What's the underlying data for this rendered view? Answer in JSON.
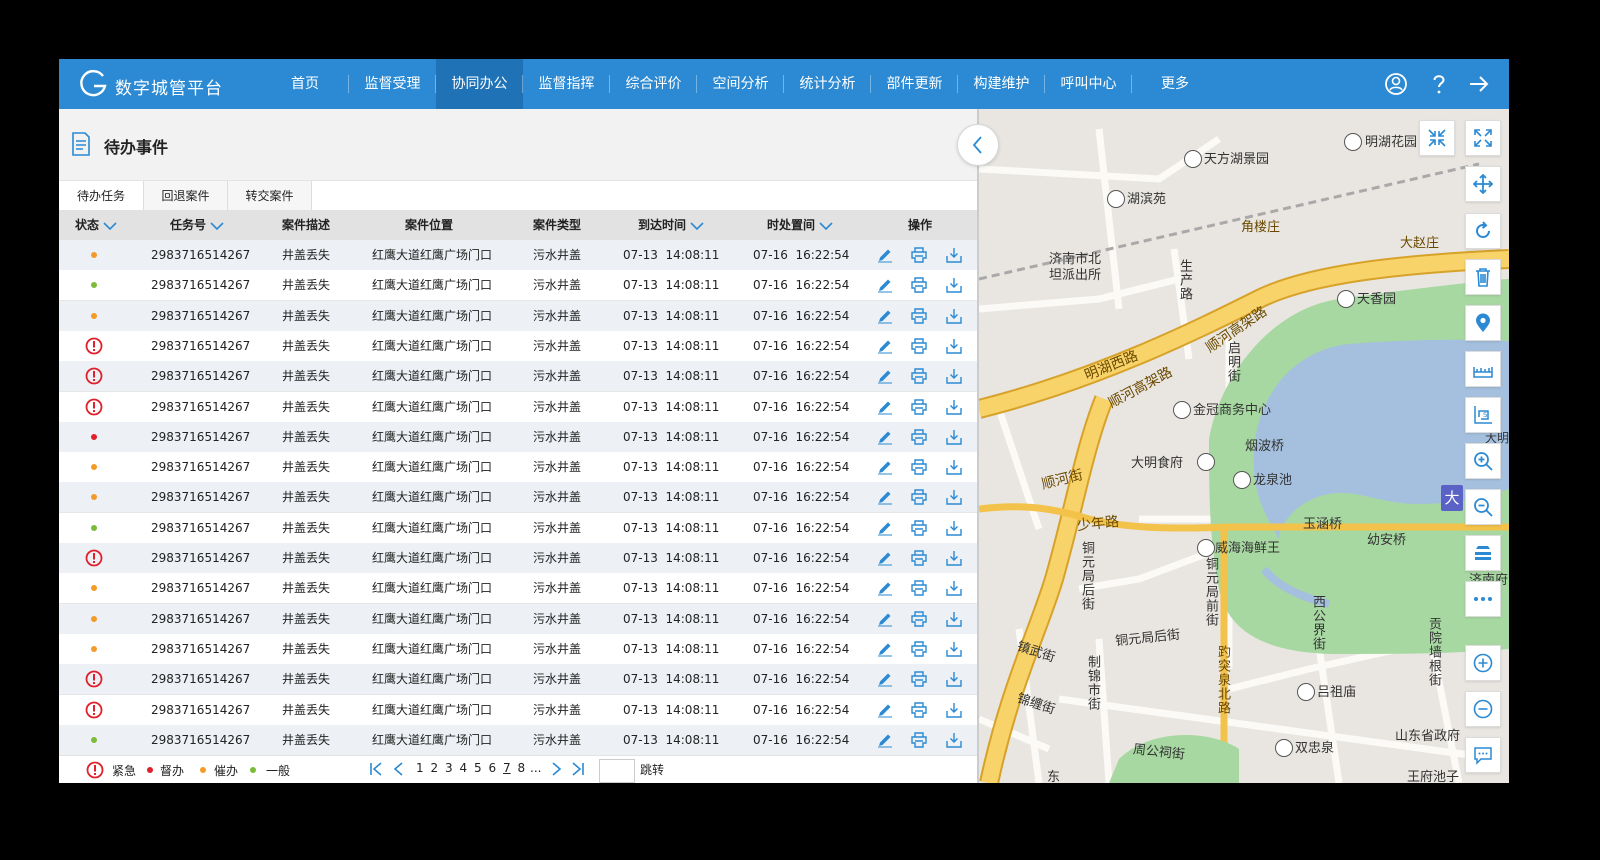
{
  "header": {
    "brand": "数字城管平台",
    "nav": [
      {
        "label": "首页"
      },
      {
        "label": "监督受理"
      },
      {
        "label": "协同办公"
      },
      {
        "label": "监督指挥"
      },
      {
        "label": "综合评价"
      },
      {
        "label": "空间分析"
      },
      {
        "label": "统计分析"
      },
      {
        "label": "部件更新"
      },
      {
        "label": "构建维护"
      },
      {
        "label": "呼叫中心"
      },
      {
        "label": "更多"
      }
    ],
    "active_nav": "协同办公",
    "icons": [
      "user-icon",
      "help-icon",
      "logout-icon"
    ],
    "color": "#2b8ad3"
  },
  "panel": {
    "title": "待办事件",
    "tabs": [
      "待办任务",
      "回退案件",
      "转交案件"
    ],
    "columns": {
      "status": "状态",
      "task_no": "任务号",
      "desc": "案件描述",
      "location": "案件位置",
      "type": "案件类型",
      "arrival": "到达时间",
      "deadline": "时处置间",
      "ops": "操作"
    },
    "rows": [
      {
        "status": "warn",
        "task_no": "2983716514267",
        "desc": "井盖丢失",
        "location": "红鹰大道红鹰广场门口",
        "type": "污水井盖",
        "arrival": "07-13  14:08:11",
        "deadline": "07-16  16:22:54"
      },
      {
        "status": "normal",
        "task_no": "2983716514267",
        "desc": "井盖丢失",
        "location": "红鹰大道红鹰广场门口",
        "type": "污水井盖",
        "arrival": "07-13  14:08:11",
        "deadline": "07-16  16:22:54"
      },
      {
        "status": "warn",
        "task_no": "2983716514267",
        "desc": "井盖丢失",
        "location": "红鹰大道红鹰广场门口",
        "type": "污水井盖",
        "arrival": "07-13  14:08:11",
        "deadline": "07-16  16:22:54"
      },
      {
        "status": "urgent",
        "task_no": "2983716514267",
        "desc": "井盖丢失",
        "location": "红鹰大道红鹰广场门口",
        "type": "污水井盖",
        "arrival": "07-13  14:08:11",
        "deadline": "07-16  16:22:54"
      },
      {
        "status": "urgent",
        "task_no": "2983716514267",
        "desc": "井盖丢失",
        "location": "红鹰大道红鹰广场门口",
        "type": "污水井盖",
        "arrival": "07-13  14:08:11",
        "deadline": "07-16  16:22:54"
      },
      {
        "status": "urgent",
        "task_no": "2983716514267",
        "desc": "井盖丢失",
        "location": "红鹰大道红鹰广场门口",
        "type": "污水井盖",
        "arrival": "07-13  14:08:11",
        "deadline": "07-16  16:22:54"
      },
      {
        "status": "supervise",
        "task_no": "2983716514267",
        "desc": "井盖丢失",
        "location": "红鹰大道红鹰广场门口",
        "type": "污水井盖",
        "arrival": "07-13  14:08:11",
        "deadline": "07-16  16:22:54"
      },
      {
        "status": "warn",
        "task_no": "2983716514267",
        "desc": "井盖丢失",
        "location": "红鹰大道红鹰广场门口",
        "type": "污水井盖",
        "arrival": "07-13  14:08:11",
        "deadline": "07-16  16:22:54"
      },
      {
        "status": "warn",
        "task_no": "2983716514267",
        "desc": "井盖丢失",
        "location": "红鹰大道红鹰广场门口",
        "type": "污水井盖",
        "arrival": "07-13  14:08:11",
        "deadline": "07-16  16:22:54"
      },
      {
        "status": "normal",
        "task_no": "2983716514267",
        "desc": "井盖丢失",
        "location": "红鹰大道红鹰广场门口",
        "type": "污水井盖",
        "arrival": "07-13  14:08:11",
        "deadline": "07-16  16:22:54"
      },
      {
        "status": "urgent",
        "task_no": "2983716514267",
        "desc": "井盖丢失",
        "location": "红鹰大道红鹰广场门口",
        "type": "污水井盖",
        "arrival": "07-13  14:08:11",
        "deadline": "07-16  16:22:54"
      },
      {
        "status": "warn",
        "task_no": "2983716514267",
        "desc": "井盖丢失",
        "location": "红鹰大道红鹰广场门口",
        "type": "污水井盖",
        "arrival": "07-13  14:08:11",
        "deadline": "07-16  16:22:54"
      },
      {
        "status": "warn",
        "task_no": "2983716514267",
        "desc": "井盖丢失",
        "location": "红鹰大道红鹰广场门口",
        "type": "污水井盖",
        "arrival": "07-13  14:08:11",
        "deadline": "07-16  16:22:54"
      },
      {
        "status": "warn",
        "task_no": "2983716514267",
        "desc": "井盖丢失",
        "location": "红鹰大道红鹰广场门口",
        "type": "污水井盖",
        "arrival": "07-13  14:08:11",
        "deadline": "07-16  16:22:54"
      },
      {
        "status": "urgent",
        "task_no": "2983716514267",
        "desc": "井盖丢失",
        "location": "红鹰大道红鹰广场门口",
        "type": "污水井盖",
        "arrival": "07-13  14:08:11",
        "deadline": "07-16  16:22:54"
      },
      {
        "status": "urgent",
        "task_no": "2983716514267",
        "desc": "井盖丢失",
        "location": "红鹰大道红鹰广场门口",
        "type": "污水井盖",
        "arrival": "07-13  14:08:11",
        "deadline": "07-16  16:22:54"
      },
      {
        "status": "normal",
        "task_no": "2983716514267",
        "desc": "井盖丢失",
        "location": "红鹰大道红鹰广场门口",
        "type": "污水井盖",
        "arrival": "07-13  14:08:11",
        "deadline": "07-16  16:22:54"
      }
    ],
    "status_colors": {
      "urgent": "#e0202a",
      "supervise": "#e0202a",
      "warn": "#f39a2b",
      "normal": "#7cba3a"
    },
    "legend": [
      "紧急",
      "督办",
      "催办",
      "一般"
    ],
    "pagination": {
      "pages": [
        "1",
        "2",
        "3",
        "4",
        "5",
        "6",
        "7",
        "8"
      ],
      "ellipsis": "...",
      "current": "7",
      "jump": "跳转"
    },
    "actions": [
      "edit-icon",
      "print-icon",
      "download-icon"
    ]
  },
  "map": {
    "labels": {
      "mhhy": "明湖花园",
      "tfhj": "天方湖景园",
      "hby": "湖滨苑",
      "jlz": "角楼庄",
      "dzz": "大赵庄",
      "pcs": "济南市北坦派出所",
      "scl": "生产路",
      "txy": "天香园",
      "mhxl": "明湖西路",
      "shgjl1": "顺河高架路",
      "shgjl2": "顺河高架路",
      "qpj": "启明街",
      "jgsw": "金冠商务中心",
      "yyq": "烟波桥",
      "dmsf": "大明食府",
      "lqc": "龙泉池",
      "shjie": "顺河街",
      "snl": "少年路",
      "yhq": "玉涵桥",
      "ylq": "幼安桥",
      "whhx": "威海海鲜王",
      "tyjhj": "铜元局后街",
      "tyjqj": "铜元局前街",
      "tyjhj2": "铜元局后街",
      "xgj": "西公界街",
      "gyqj": "贡院墙根街",
      "zwj": "镇武街",
      "zjsj": "制锦市街",
      "jtj": "锦缠街",
      "qqbl": "趵突泉北路",
      "lzm": "吕祖庙",
      "sdszf": "山东省政府",
      "zgcj": "周公祠街",
      "szq": "双忠泉",
      "wfcz": "王府池子",
      "jnf": "济南府",
      "dong": "东",
      "da": "大",
      "dming": "大明"
    }
  }
}
